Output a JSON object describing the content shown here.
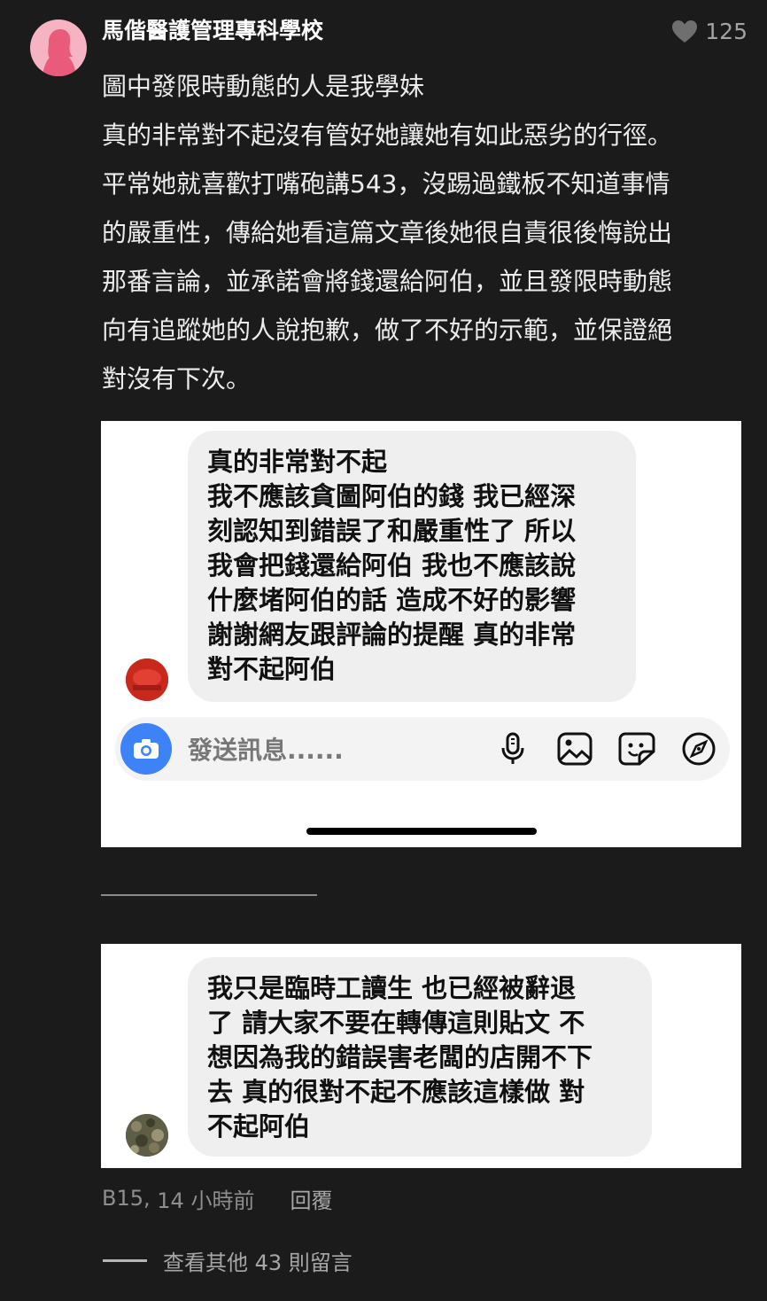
{
  "comment": {
    "author": "馬偕醫護管理專科學校",
    "like_count": "125",
    "lines": [
      "圖中發限時動態的人是我學妹",
      "真的非常對不起沒有管好她讓她有如此惡劣的行徑。",
      "平常她就喜歡打嘴砲講543，沒踢過鐵板不知道事情",
      "的嚴重性，傳給她看這篇文章後她很自責很後悔說出",
      "那番言論，並承諾會將錢還給阿伯，並且發限時動態",
      "向有追蹤她的人說抱歉，做了不好的示範，並保證絕",
      "對沒有下次。"
    ],
    "floor": "B15",
    "time": "14 小時前",
    "reply_label": "回覆",
    "more_replies": "查看其他 43 則留言"
  },
  "screenshot1": {
    "message": "真的非常對不起\n我不應該貪圖阿伯的錢 我已經深\n刻認知到錯誤了和嚴重性了 所以\n我會把錢還給阿伯 我也不應該說\n什麼堵阿伯的話 造成不好的影響\n謝謝網友跟評論的提醒 真的非常\n對不起阿伯",
    "composer_placeholder": "發送訊息......"
  },
  "screenshot2": {
    "message": "我只是臨時工讀生 也已經被辭退\n了 請大家不要在轉傳這則貼文 不\n想因為我的錯誤害老闆的店開不下\n去 真的很對不起不應該這樣做 對\n不起阿伯"
  }
}
